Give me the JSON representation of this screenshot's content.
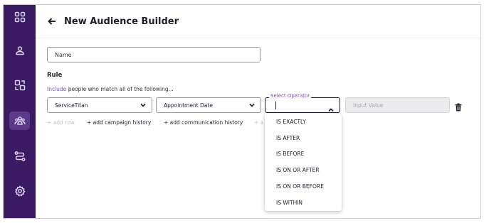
{
  "header": {
    "title": "New Audience Builder"
  },
  "sidebar": {
    "items": [
      {
        "icon": "apps-grid-icon"
      },
      {
        "icon": "user-icon"
      },
      {
        "icon": "shapes-icon"
      },
      {
        "icon": "audience-icon",
        "active": true
      },
      {
        "icon": "workflow-icon"
      },
      {
        "icon": "settings-gear-icon"
      }
    ]
  },
  "form": {
    "name_placeholder": "Name",
    "rule_label": "Rule",
    "rule_desc_accent": "Include",
    "rule_desc_rest": " people who match all of the following..."
  },
  "row": {
    "source_value": "ServiceTitan",
    "field_value": "Appointment Date",
    "operator_legend": "Select Operator",
    "value_placeholder": "Input Value"
  },
  "links": {
    "add_row": "+ add row",
    "add_campaign_history": "+ add campaign history",
    "add_communication_history": "+ add communication history",
    "add_more_truncated": "+ a"
  },
  "operator_options": [
    "IS EXACTLY",
    "IS AFTER",
    "IS BEFORE",
    "IS ON OR AFTER",
    "IS ON OR BEFORE",
    "IS WITHIN"
  ]
}
